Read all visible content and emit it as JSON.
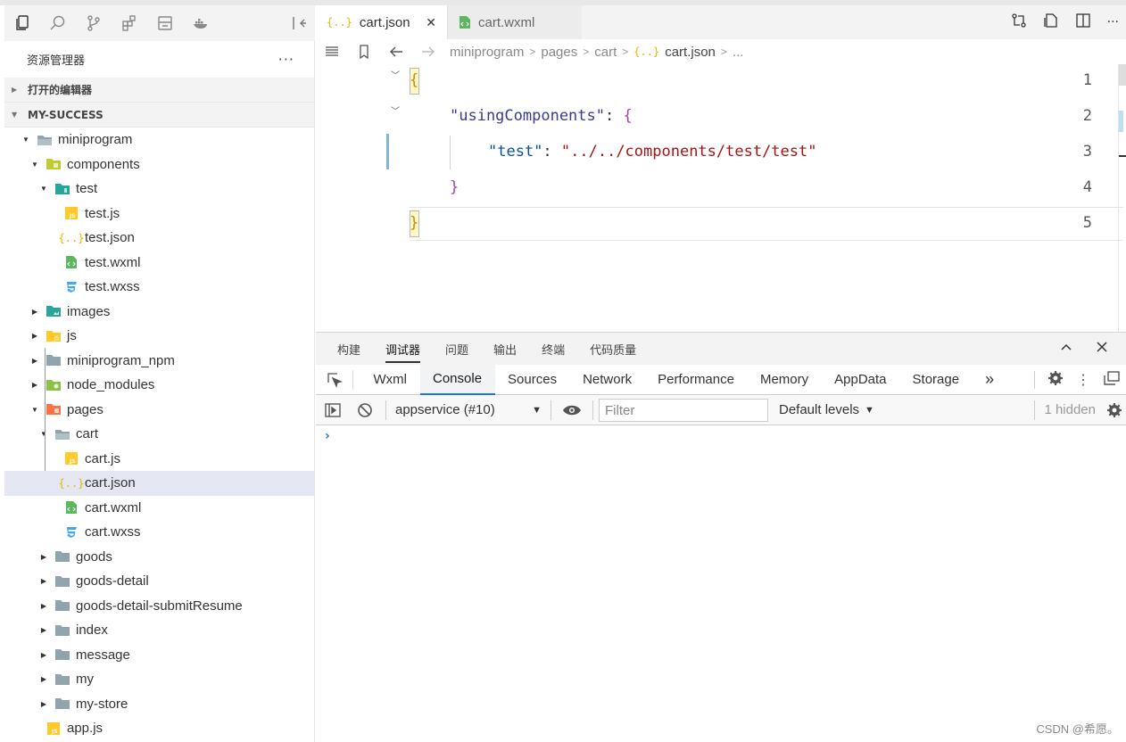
{
  "explorer": {
    "title": "资源管理器",
    "more": "···",
    "open_editors": "打开的编辑器",
    "project": "MY-SUCCESS"
  },
  "tree": [
    {
      "label": "miniprogram",
      "icon": "folder-open",
      "expanded": true
    },
    {
      "label": "components",
      "icon": "folder-components",
      "expanded": true
    },
    {
      "label": "test",
      "icon": "folder-test",
      "expanded": true
    },
    {
      "label": "test.js",
      "icon": "js-file"
    },
    {
      "label": "test.json",
      "icon": "json-file"
    },
    {
      "label": "test.wxml",
      "icon": "wxml-file"
    },
    {
      "label": "test.wxss",
      "icon": "wxss-file"
    },
    {
      "label": "images",
      "icon": "folder-images"
    },
    {
      "label": "js",
      "icon": "folder-js"
    },
    {
      "label": "miniprogram_npm",
      "icon": "folder"
    },
    {
      "label": "node_modules",
      "icon": "folder-node"
    },
    {
      "label": "pages",
      "icon": "folder-pages",
      "expanded": true
    },
    {
      "label": "cart",
      "icon": "folder-open",
      "expanded": true
    },
    {
      "label": "cart.js",
      "icon": "js-file"
    },
    {
      "label": "cart.json",
      "icon": "json-file",
      "selected": true
    },
    {
      "label": "cart.wxml",
      "icon": "wxml-file"
    },
    {
      "label": "cart.wxss",
      "icon": "wxss-file"
    },
    {
      "label": "goods",
      "icon": "folder"
    },
    {
      "label": "goods-detail",
      "icon": "folder"
    },
    {
      "label": "goods-detail-submitResume",
      "icon": "folder"
    },
    {
      "label": "index",
      "icon": "folder"
    },
    {
      "label": "message",
      "icon": "folder"
    },
    {
      "label": "my",
      "icon": "folder"
    },
    {
      "label": "my-store",
      "icon": "folder"
    },
    {
      "label": "app.js",
      "icon": "js-file"
    }
  ],
  "tabs": [
    {
      "label": "cart.json",
      "icon": "json-file",
      "active": true,
      "close": "✕"
    },
    {
      "label": "cart.wxml",
      "icon": "wxml-file",
      "active": false
    }
  ],
  "breadcrumb": [
    "miniprogram",
    "pages",
    "cart",
    "cart.json",
    "..."
  ],
  "code": {
    "line_numbers": [
      "1",
      "2",
      "3",
      "4",
      "5"
    ],
    "l1_brace": "{",
    "l2_key": "\"usingComponents\"",
    "l2_colon": ": ",
    "l2_brace": "{",
    "l3_key": "\"test\"",
    "l3_colon": ": ",
    "l3_value": "\"../../components/test/test\"",
    "l4_brace": "}",
    "l5_brace": "}"
  },
  "devtools": {
    "top_tabs": [
      "构建",
      "调试器",
      "问题",
      "输出",
      "终端",
      "代码质量"
    ],
    "active_top": "调试器",
    "panel_tabs": [
      "Wxml",
      "Console",
      "Sources",
      "Network",
      "Performance",
      "Memory",
      "AppData",
      "Storage"
    ],
    "active_panel": "Console",
    "more_tabs": "»",
    "context": "appservice (#10)",
    "filter_placeholder": "Filter",
    "levels": "Default levels",
    "hidden": "1 hidden",
    "prompt": "›"
  },
  "colors": {
    "accent": "#1a73e8",
    "json_key": "#0451a5",
    "json_string": "#a31515",
    "brace_outer": "#c48c00",
    "brace_inner": "#a83dbb"
  },
  "watermark": "CSDN @希愿。"
}
